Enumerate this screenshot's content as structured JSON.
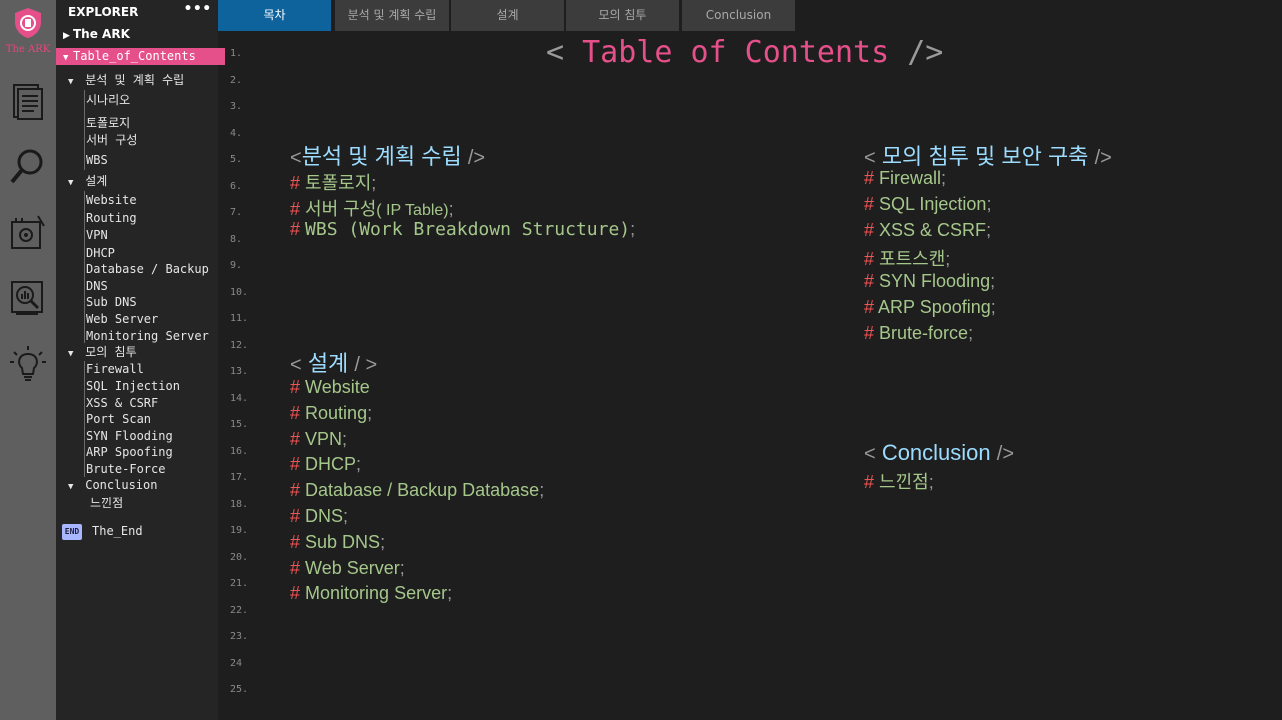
{
  "app": {
    "logo_text": "The ARK"
  },
  "activity_icons": [
    "document-icon",
    "search-icon",
    "network-tools-icon",
    "analytics-icon",
    "lightbulb-icon"
  ],
  "explorer": {
    "header": "EXPLORER",
    "more": "•••",
    "root": "The ARK",
    "selected": "Table_of_Contents",
    "groups": [
      {
        "label": "분석 및 계획 수립",
        "items": [
          "시나리오",
          "토폴로지",
          "서버 구성",
          "WBS"
        ]
      },
      {
        "label": "설계",
        "items": [
          "Website",
          "Routing",
          "VPN",
          "DHCP",
          "Database / Backup",
          "DNS",
          "Sub DNS",
          "Web Server",
          "Monitoring Server"
        ]
      },
      {
        "label": "모의 침투",
        "items": [
          "Firewall",
          "SQL Injection",
          "XSS & CSRF",
          "Port Scan",
          "SYN Flooding",
          "ARP Spoofing",
          "Brute-Force"
        ]
      },
      {
        "label": "Conclusion",
        "items": [
          "느낀점"
        ]
      }
    ],
    "end_badge": "END",
    "end_label": "The_End"
  },
  "tabs": [
    "목차",
    "분석 및 계획 수립",
    "설계",
    "모의 침투",
    "Conclusion"
  ],
  "line_numbers": [
    "1.",
    "2.",
    "3.",
    "4.",
    "5.",
    "6.",
    "7.",
    "8.",
    "9.",
    "10.",
    "11.",
    "12.",
    "13.",
    "14.",
    "15.",
    "16.",
    "17.",
    "18.",
    "19.",
    "20.",
    "21.",
    "22.",
    "23.",
    "24",
    "25."
  ],
  "content": {
    "title": {
      "open": "<",
      "text": "Table of Contents",
      "close": "/>"
    },
    "section1": {
      "open": "<",
      "label": "분석 및 계획 수립",
      "close": "/>",
      "items": [
        {
          "text": "토폴로지",
          "end": ";"
        },
        {
          "text": "서버 구성",
          "note": "( IP Table)",
          "end": ";"
        },
        {
          "text": "WBS (Work Breakdown Structure)",
          "end": ";"
        }
      ]
    },
    "section2": {
      "open": "<",
      "label": "설계",
      "close": "/ >",
      "items": [
        {
          "text": "Website",
          "end": ""
        },
        {
          "text": "Routing",
          "end": ";"
        },
        {
          "text": "VPN",
          "end": ";"
        },
        {
          "text": "DHCP",
          "end": ";"
        },
        {
          "text": "Database / Backup Database",
          "end": ";"
        },
        {
          "text": "DNS",
          "end": ";"
        },
        {
          "text": "Sub DNS",
          "end": ";"
        },
        {
          "text": "Web Server",
          "end": ";"
        },
        {
          "text": "Monitoring Server",
          "end": ";"
        }
      ]
    },
    "section3": {
      "open": "<",
      "label": "모의 침투 및 보안 구축",
      "close": "/>",
      "items": [
        {
          "text": "Firewall",
          "end": ";"
        },
        {
          "text": "SQL Injection",
          "end": ";"
        },
        {
          "text": "XSS & CSRF",
          "end": ";"
        },
        {
          "text": "포트스캔",
          "end": ";"
        },
        {
          "text": "SYN Flooding",
          "end": ";"
        },
        {
          "text": "ARP Spoofing",
          "end": ";"
        },
        {
          "text": "Brute-force",
          "end": ";"
        }
      ]
    },
    "section4": {
      "open": "<",
      "label": "Conclusion",
      "close": "/>",
      "items": [
        {
          "text": "느낀점",
          "end": ";"
        }
      ]
    },
    "hash": "#"
  },
  "colors": {
    "accent_pink": "#e6508a",
    "tab_active": "#0e639c",
    "keyword_blue": "#9cdcfe",
    "comment_green": "#a5c78b",
    "hash_red": "#f05454"
  }
}
